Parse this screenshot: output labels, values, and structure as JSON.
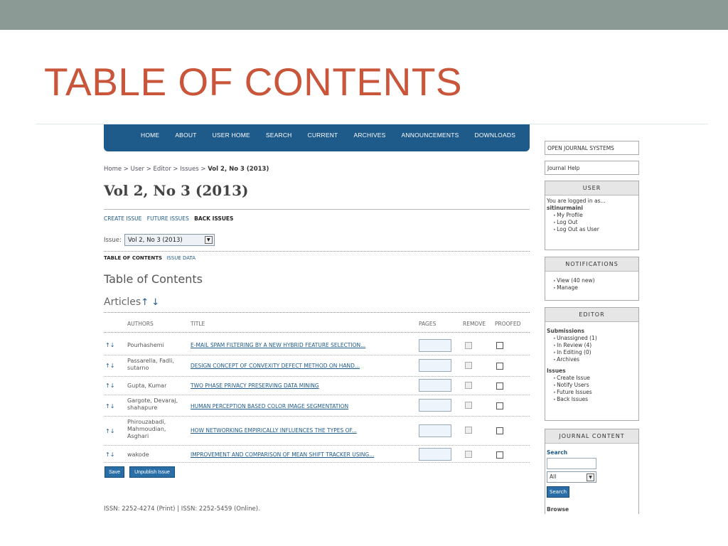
{
  "slide": {
    "title": "TABLE OF CONTENTS"
  },
  "nav": [
    "HOME",
    "ABOUT",
    "USER HOME",
    "SEARCH",
    "CURRENT",
    "ARCHIVES",
    "ANNOUNCEMENTS",
    "DOWNLOADS"
  ],
  "breadcrumb": {
    "home": "Home",
    "sep": " > ",
    "user": "User",
    "editor": "Editor",
    "issues": "Issues",
    "current": "Vol 2, No 3 (2013)"
  },
  "page": {
    "title": "Vol 2, No 3 (2013)",
    "sub_links": [
      "CREATE ISSUE",
      "FUTURE ISSUES"
    ],
    "sub_active": "BACK ISSUES",
    "issue_label": "Issue:",
    "issue_value": "Vol 2, No 3 (2013)",
    "toc_tab_active": "TABLE OF CONTENTS",
    "toc_tab_other": "ISSUE DATA",
    "toc_heading": "Table of Contents",
    "section": "Articles",
    "section_arrows": "↑ ↓"
  },
  "table": {
    "headers": {
      "authors": "AUTHORS",
      "title": "TITLE",
      "pages": "PAGES",
      "remove": "REMOVE",
      "proofed": "PROOFED"
    },
    "rows": [
      {
        "arrows": "↑↓",
        "authors": "Pourhashemi",
        "title": "E-MAIL SPAM FILTERING BY A NEW HYBRID FEATURE SELECTION..."
      },
      {
        "arrows": "↑↓",
        "authors": "Passarella, Fadli, sutarno",
        "title": "DESIGN CONCEPT OF CONVEXITY DEFECT METHOD ON HAND..."
      },
      {
        "arrows": "↑↓",
        "authors": "Gupta, Kumar",
        "title": "TWO PHASE PRIVACY PRESERVING DATA MINING"
      },
      {
        "arrows": "↑↓",
        "authors": "Gargote, Devaraj, shahapure",
        "title": "HUMAN PERCEPTION BASED COLOR IMAGE SEGMENTATION"
      },
      {
        "arrows": "↑↓",
        "authors": "Phirouzabadi, Mahmoudian, Asghari",
        "title": "HOW NETWORKING EMPIRICALLY INFLUENCES THE TYPES OF..."
      },
      {
        "arrows": "↑↓",
        "authors": "wakode",
        "title": "IMPROVEMENT AND COMPARISON OF MEAN SHIFT TRACKER USING..."
      }
    ]
  },
  "buttons": {
    "save": "Save",
    "unpublish": "Unpublish Issue"
  },
  "footer": "ISSN: 2252-4274 (Print) | ISSN: 2252-5459 (Online).",
  "sidebar": {
    "ojs": "OPEN JOURNAL SYSTEMS",
    "help": "Journal Help",
    "user": {
      "head": "USER",
      "logged": "You are logged in as...",
      "name": "sitinurmaini",
      "links": [
        "My Profile",
        "Log Out",
        "Log Out as User"
      ]
    },
    "notifications": {
      "head": "NOTIFICATIONS",
      "links": [
        "View (40 new)",
        "Manage"
      ]
    },
    "editor": {
      "head": "EDITOR",
      "submissions_label": "Submissions",
      "submissions": [
        "Unassigned (1)",
        "In Review (4)",
        "In Editing (0)",
        "Archives"
      ],
      "issues_label": "Issues",
      "issues": [
        "Create Issue",
        "Notify Users",
        "Future Issues",
        "Back Issues"
      ]
    },
    "journal_content": {
      "head": "JOURNAL CONTENT",
      "search_label": "Search",
      "select_value": "All",
      "search_button": "Search",
      "browse": "Browse"
    }
  }
}
